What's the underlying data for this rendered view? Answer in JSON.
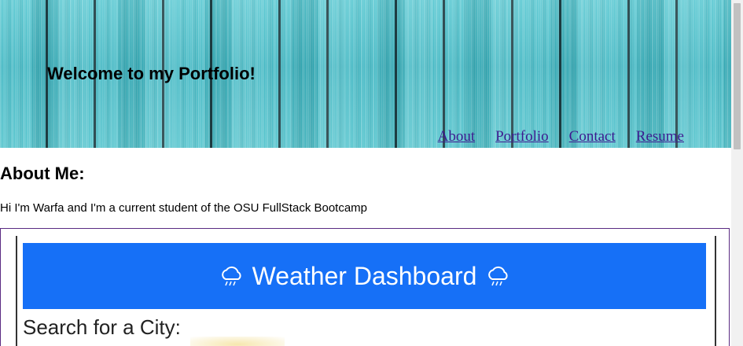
{
  "header": {
    "title": "Welcome to my Portfolio!",
    "nav": [
      {
        "label": "About"
      },
      {
        "label": "Portfolio"
      },
      {
        "label": "Contact"
      },
      {
        "label": "Resume"
      }
    ]
  },
  "about": {
    "heading": "About Me:",
    "text": "Hi I'm Warfa and I'm a current student of the OSU FullStack Bootcamp"
  },
  "project_preview": {
    "banner_title": "Weather Dashboard",
    "banner_icon": "cloud-rain-icon",
    "search_label": "Search for a City:",
    "banner_color": "#1670f7"
  },
  "colors": {
    "header_teal": "#3fb8c4",
    "nav_link": "#3d1a8f",
    "frame_border": "#5a2a82"
  }
}
